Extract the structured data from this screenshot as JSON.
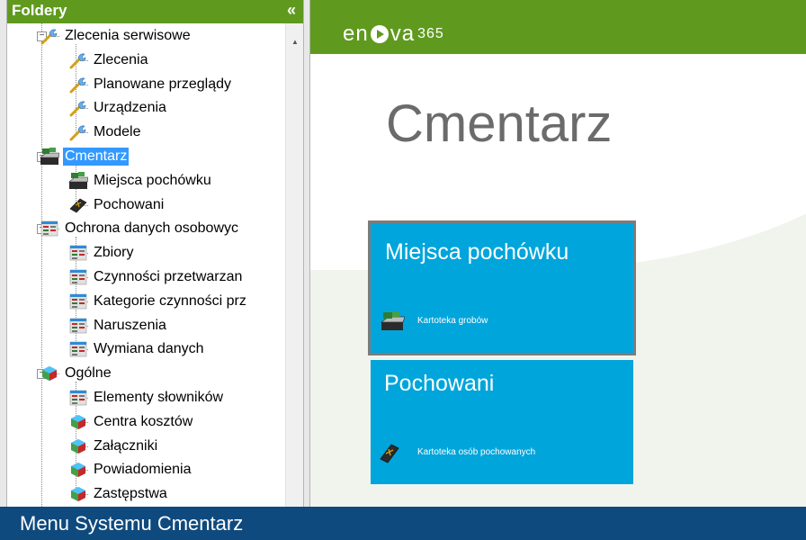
{
  "folders": {
    "title": "Foldery",
    "collapse_icon": "«",
    "items": [
      {
        "label": "Zlecenia serwisowe",
        "icon": "wrench-icon",
        "level": 1,
        "expander": "minus"
      },
      {
        "label": "Zlecenia",
        "icon": "wrench-icon",
        "level": 2
      },
      {
        "label": "Planowane przeglądy",
        "icon": "wrench-icon",
        "level": 2
      },
      {
        "label": "Urządzenia",
        "icon": "wrench-icon",
        "level": 2
      },
      {
        "label": "Modele",
        "icon": "wrench-icon",
        "level": 2
      },
      {
        "label": "Cmentarz",
        "icon": "grave-icon",
        "level": 1,
        "expander": "minus",
        "selected": true
      },
      {
        "label": "Miejsca pochówku",
        "icon": "grave-icon",
        "level": 2
      },
      {
        "label": "Pochowani",
        "icon": "coffin-icon",
        "level": 2
      },
      {
        "label": "Ochrona danych osobowyc",
        "icon": "table-icon",
        "level": 1,
        "expander": "minus"
      },
      {
        "label": "Zbiory",
        "icon": "table-icon",
        "level": 2
      },
      {
        "label": "Czynności przetwarzan",
        "icon": "table-icon",
        "level": 2
      },
      {
        "label": "Kategorie czynności prz",
        "icon": "table-icon",
        "level": 2
      },
      {
        "label": "Naruszenia",
        "icon": "table-icon",
        "level": 2
      },
      {
        "label": "Wymiana danych",
        "icon": "table-icon",
        "level": 2
      },
      {
        "label": "Ogólne",
        "icon": "cube-icon",
        "level": 1,
        "expander": "minus"
      },
      {
        "label": "Elementy słowników",
        "icon": "table-icon",
        "level": 2
      },
      {
        "label": "Centra kosztów",
        "icon": "cube-icon",
        "level": 2
      },
      {
        "label": "Załączniki",
        "icon": "cube-icon",
        "level": 2
      },
      {
        "label": "Powiadomienia",
        "icon": "cube-icon",
        "level": 2
      },
      {
        "label": "Zastępstwa",
        "icon": "cube-icon",
        "level": 2
      }
    ]
  },
  "brand": {
    "logo_prefix": "en",
    "logo_suffix": "va",
    "logo_number": "365"
  },
  "page": {
    "title": "Cmentarz"
  },
  "tiles": [
    {
      "title": "Miejsca pochówku",
      "subtitle": "Kartoteka grobów",
      "icon": "grave-icon"
    },
    {
      "title": "Pochowani",
      "subtitle": "Kartoteka osób pochowanych",
      "icon": "coffin-icon"
    }
  ],
  "caption": {
    "text": "Menu Systemu Cmentarz"
  },
  "colors": {
    "green": "#5f9a1f",
    "tile_blue": "#00a5db",
    "selection_blue": "#3399ff",
    "caption_navy": "#0f4a7e"
  }
}
